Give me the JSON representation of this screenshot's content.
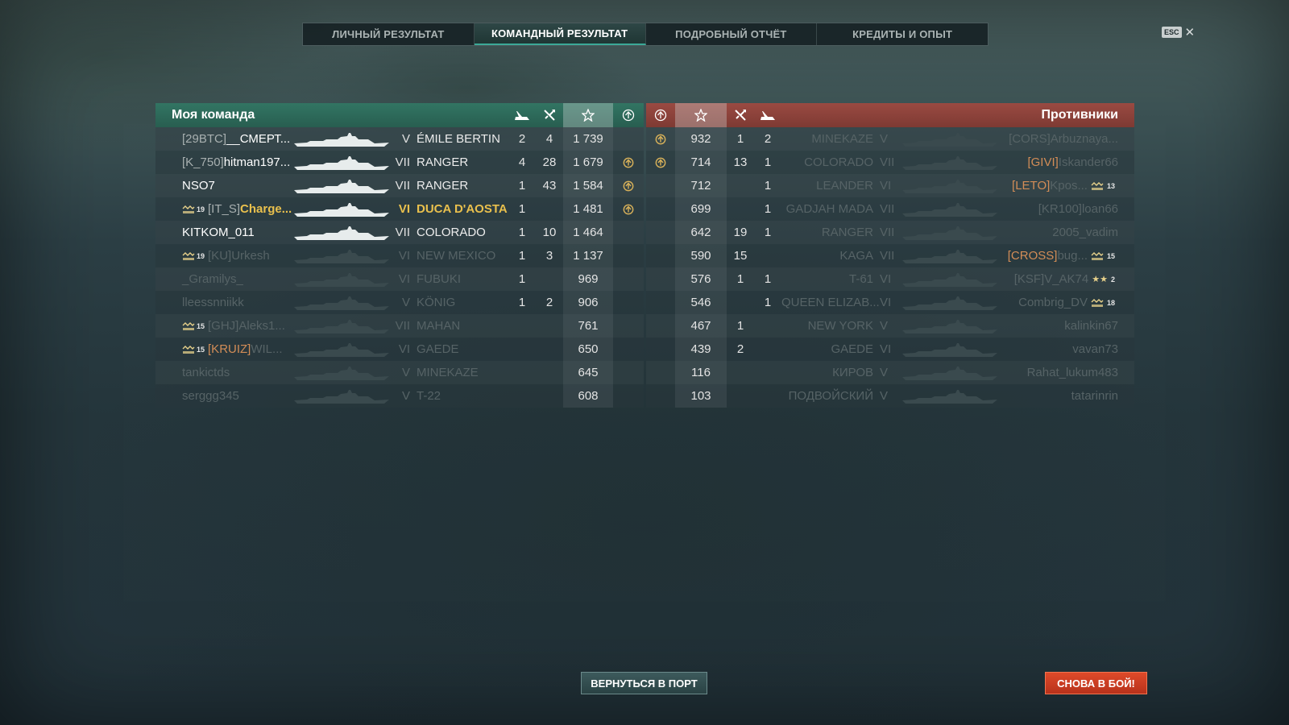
{
  "tabs": [
    {
      "label": "ЛИЧНЫЙ РЕЗУЛЬТАТ",
      "active": false
    },
    {
      "label": "КОМАНДНЫЙ РЕЗУЛЬТАТ",
      "active": true
    },
    {
      "label": "ПОДРОБНЫЙ ОТЧЁТ",
      "active": false
    },
    {
      "label": "КРЕДИТЫ И ОПЫТ",
      "active": false
    }
  ],
  "esc_label": "ESC",
  "close_glyph": "✕",
  "colors": {
    "accent_teal": "#3ba997",
    "my_team": "#327563",
    "enemy_team": "#9a4a42",
    "highlight": "#e9c04d",
    "clan_orange": "#d38d57",
    "battle_button": "#de4a2a"
  },
  "my_team": {
    "title": "Моя команда",
    "column_icons": [
      "ships-destroyed-icon",
      "planes-destroyed-icon",
      "base-xp-star-icon",
      "capture-icon"
    ],
    "players": [
      {
        "rank": "",
        "clan": "[29BTC]",
        "clan_orange": false,
        "name": "__СМЕРТ...",
        "tier": "V",
        "ship": "ÉMILE BERTIN",
        "kills": "2",
        "planes": "4",
        "xp": "1 739",
        "cap": false,
        "alive": true,
        "mine": false
      },
      {
        "rank": "",
        "clan": "[K_750]",
        "clan_orange": false,
        "name": "hitman197...",
        "tier": "VII",
        "ship": "RANGER",
        "kills": "4",
        "planes": "28",
        "xp": "1 679",
        "cap": true,
        "alive": true,
        "mine": false
      },
      {
        "rank": "",
        "clan": "",
        "clan_orange": false,
        "name": "NSO7",
        "tier": "VII",
        "ship": "RANGER",
        "kills": "1",
        "planes": "43",
        "xp": "1 584",
        "cap": true,
        "alive": true,
        "mine": false
      },
      {
        "rank": "19",
        "clan": "[IT_S]",
        "clan_orange": false,
        "name": "Charge...",
        "tier": "VI",
        "ship": "DUCA D'AOSTA",
        "kills": "1",
        "planes": "",
        "xp": "1 481",
        "cap": true,
        "alive": true,
        "mine": true
      },
      {
        "rank": "",
        "clan": "",
        "clan_orange": false,
        "name": "KITKOM_011",
        "tier": "VII",
        "ship": "COLORADO",
        "kills": "1",
        "planes": "10",
        "xp": "1 464",
        "cap": false,
        "alive": true,
        "mine": false
      },
      {
        "rank": "19",
        "clan": "[KU]",
        "clan_orange": false,
        "name": "Urkesh",
        "tier": "VI",
        "ship": "NEW MEXICO",
        "kills": "1",
        "planes": "3",
        "xp": "1 137",
        "cap": false,
        "alive": false,
        "mine": false
      },
      {
        "rank": "",
        "clan": "",
        "clan_orange": false,
        "name": "_Gramilys_",
        "tier": "VI",
        "ship": "FUBUKI",
        "kills": "1",
        "planes": "",
        "xp": "969",
        "cap": false,
        "alive": false,
        "mine": false
      },
      {
        "rank": "",
        "clan": "",
        "clan_orange": false,
        "name": "lleessnniikk",
        "tier": "V",
        "ship": "KÖNIG",
        "kills": "1",
        "planes": "2",
        "xp": "906",
        "cap": false,
        "alive": false,
        "mine": false
      },
      {
        "rank": "15",
        "clan": "[GHJ]",
        "clan_orange": false,
        "name": "Aleks1...",
        "tier": "VII",
        "ship": "MAHAN",
        "kills": "",
        "planes": "",
        "xp": "761",
        "cap": false,
        "alive": false,
        "mine": false
      },
      {
        "rank": "15",
        "clan": "[KRUIZ]",
        "clan_orange": true,
        "name": "WIL...",
        "tier": "VI",
        "ship": "GAEDE",
        "kills": "",
        "planes": "",
        "xp": "650",
        "cap": false,
        "alive": false,
        "mine": false
      },
      {
        "rank": "",
        "clan": "",
        "clan_orange": false,
        "name": "tankictds",
        "tier": "V",
        "ship": "MINEKAZE",
        "kills": "",
        "planes": "",
        "xp": "645",
        "cap": false,
        "alive": false,
        "mine": false
      },
      {
        "rank": "",
        "clan": "",
        "clan_orange": false,
        "name": "serggg345",
        "tier": "V",
        "ship": "T-22",
        "kills": "",
        "planes": "",
        "xp": "608",
        "cap": false,
        "alive": false,
        "mine": false
      }
    ]
  },
  "enemy_team": {
    "title": "Противники",
    "players": [
      {
        "cap": true,
        "xp": "932",
        "planes": "1",
        "kills": "2",
        "ship": "MINEKAZE",
        "tier": "V",
        "clan": "[CORS]",
        "clan_orange": false,
        "name": "Arbuznaya...",
        "rank": "",
        "rank_type": "",
        "alive": false
      },
      {
        "cap": true,
        "xp": "714",
        "planes": "13",
        "kills": "1",
        "ship": "COLORADO",
        "tier": "VII",
        "clan": "[GIVI]",
        "clan_orange": true,
        "name": "Iskander66",
        "rank": "",
        "rank_type": "",
        "alive": false
      },
      {
        "cap": false,
        "xp": "712",
        "planes": "",
        "kills": "1",
        "ship": "LEANDER",
        "tier": "VI",
        "clan": "[LETO]",
        "clan_orange": true,
        "name": "Kpos...",
        "rank": "13",
        "rank_type": "ribbon",
        "alive": false
      },
      {
        "cap": false,
        "xp": "699",
        "planes": "",
        "kills": "1",
        "ship": "GADJAH MADA",
        "tier": "VII",
        "clan": "[KR100]",
        "clan_orange": false,
        "name": "loan66",
        "rank": "",
        "rank_type": "",
        "alive": false
      },
      {
        "cap": false,
        "xp": "642",
        "planes": "19",
        "kills": "1",
        "ship": "RANGER",
        "tier": "VII",
        "clan": "",
        "clan_orange": false,
        "name": "2005_vadim",
        "rank": "",
        "rank_type": "",
        "alive": false
      },
      {
        "cap": false,
        "xp": "590",
        "planes": "15",
        "kills": "",
        "ship": "KAGA",
        "tier": "VII",
        "clan": "[CROSS]",
        "clan_orange": true,
        "name": "bug...",
        "rank": "15",
        "rank_type": "ribbon",
        "alive": false
      },
      {
        "cap": false,
        "xp": "576",
        "planes": "1",
        "kills": "1",
        "ship": "T-61",
        "tier": "VI",
        "clan": "[KSF]",
        "clan_orange": false,
        "name": "V_AK74",
        "rank": "2",
        "rank_type": "stars",
        "alive": false
      },
      {
        "cap": false,
        "xp": "546",
        "planes": "",
        "kills": "1",
        "ship": "QUEEN ELIZAB...",
        "tier": "VI",
        "clan": "",
        "clan_orange": false,
        "name": "Combrig_DV",
        "rank": "18",
        "rank_type": "ribbon",
        "alive": false
      },
      {
        "cap": false,
        "xp": "467",
        "planes": "1",
        "kills": "",
        "ship": "NEW YORK",
        "tier": "V",
        "clan": "",
        "clan_orange": false,
        "name": "kalinkin67",
        "rank": "",
        "rank_type": "",
        "alive": false
      },
      {
        "cap": false,
        "xp": "439",
        "planes": "2",
        "kills": "",
        "ship": "GAEDE",
        "tier": "VI",
        "clan": "",
        "clan_orange": false,
        "name": "vavan73",
        "rank": "",
        "rank_type": "",
        "alive": false
      },
      {
        "cap": false,
        "xp": "116",
        "planes": "",
        "kills": "",
        "ship": "КИРОВ",
        "tier": "V",
        "clan": "",
        "clan_orange": false,
        "name": "Rahat_lukum483",
        "rank": "",
        "rank_type": "",
        "alive": false
      },
      {
        "cap": false,
        "xp": "103",
        "planes": "",
        "kills": "",
        "ship": "ПОДВОЙСКИЙ",
        "tier": "V",
        "clan": "",
        "clan_orange": false,
        "name": "tatarinrin",
        "rank": "",
        "rank_type": "",
        "alive": false
      }
    ]
  },
  "buttons": {
    "return_port": "ВЕРНУТЬСЯ В ПОРТ",
    "battle_again": "СНОВА В БОЙ!"
  }
}
